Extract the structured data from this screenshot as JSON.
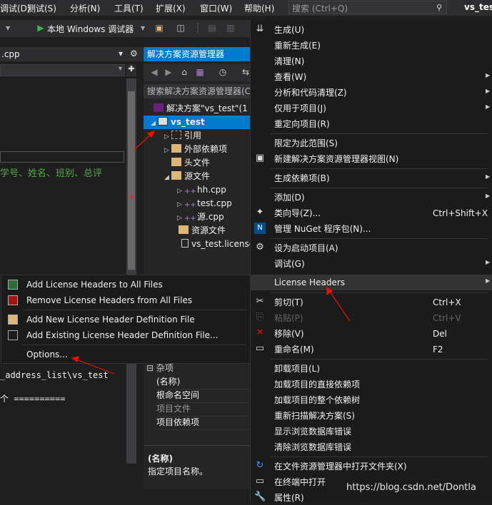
{
  "menubar": {
    "items": [
      "调试(D)",
      "测试(S)",
      "分析(N)",
      "工具(T)",
      "扩展(X)",
      "窗口(W)",
      "帮助(H)"
    ],
    "search_placeholder": "搜索 (Ctrl+Q)",
    "window_title": "vs_test"
  },
  "toolbar": {
    "debugger_label": "本地 Windows 调试器"
  },
  "editor": {
    "file_tab": ".cpp",
    "code_line_1": "学号、姓名、班别、总评",
    "output_line_1": "_address_list\\vs_test",
    "output_line_2": "个 =========="
  },
  "solution_explorer": {
    "title": "解决方案资源管理器",
    "search_placeholder": "搜索解决方案资源管理器(C",
    "tree": [
      {
        "label": "解决方案\"vs_test\"(1",
        "icon": "solution-icon"
      },
      {
        "label": "vs_test",
        "icon": "project-icon",
        "selected": true
      },
      {
        "label": "引用",
        "icon": "references-icon"
      },
      {
        "label": "外部依赖项",
        "icon": "folder-icon"
      },
      {
        "label": "头文件",
        "icon": "folder-icon"
      },
      {
        "label": "源文件",
        "icon": "folder-icon"
      },
      {
        "label": "hh.cpp",
        "icon": "cpp-file-icon"
      },
      {
        "label": "test.cpp",
        "icon": "cpp-file-icon"
      },
      {
        "label": "源.cpp",
        "icon": "cpp-file-icon"
      },
      {
        "label": "资源文件",
        "icon": "folder-icon"
      },
      {
        "label": "vs_test.license",
        "icon": "file-icon"
      }
    ]
  },
  "properties": {
    "category": "杂项",
    "rows": [
      "(名称)",
      "根命名空间",
      "项目文件",
      "项目依赖项"
    ],
    "desc_title": "(名称)",
    "desc_text": "指定项目名称。"
  },
  "context_menu": {
    "items": [
      {
        "label": "生成(U)"
      },
      {
        "label": "重新生成(E)"
      },
      {
        "label": "清理(N)"
      },
      {
        "label": "查看(W)"
      },
      {
        "label": "分析和代码清理(Z)"
      },
      {
        "label": "仅用于项目(J)"
      },
      {
        "label": "重定向项目(R)"
      },
      {
        "label": "限定为此范围(S)"
      },
      {
        "label": "新建解决方案资源管理器视图(N)"
      },
      {
        "label": "生成依赖项(B)"
      },
      {
        "label": "添加(D)"
      },
      {
        "label": "类向导(Z)...",
        "shortcut": "Ctrl+Shift+X"
      },
      {
        "label": "管理 NuGet 程序包(N)..."
      },
      {
        "label": "设为启动项目(A)"
      },
      {
        "label": "调试(G)"
      },
      {
        "label": "License Headers"
      },
      {
        "label": "剪切(T)",
        "shortcut": "Ctrl+X"
      },
      {
        "label": "粘贴(P)",
        "shortcut": "Ctrl+V"
      },
      {
        "label": "移除(V)",
        "shortcut": "Del"
      },
      {
        "label": "重命名(M)",
        "shortcut": "F2"
      },
      {
        "label": "卸载项目(L)"
      },
      {
        "label": "加载项目的直接依赖项"
      },
      {
        "label": "加载项目的整个依赖树"
      },
      {
        "label": "重新扫描解决方案(S)"
      },
      {
        "label": "显示浏览数据库错误"
      },
      {
        "label": "清除浏览数据库错误"
      },
      {
        "label": "在文件资源管理器中打开文件夹(X)"
      },
      {
        "label": "在终端中打开"
      },
      {
        "label": "属性(R)"
      }
    ]
  },
  "submenu": {
    "items": [
      "Add License Headers to All Files",
      "Remove License Headers from All Files",
      "Add New License Header Definition File",
      "Add Existing License Header Definition File...",
      "Options..."
    ]
  },
  "watermark": "https://blog.csdn.net/Dontla",
  "colors": {
    "accent": "#007acc",
    "arrow": "#e51400"
  }
}
